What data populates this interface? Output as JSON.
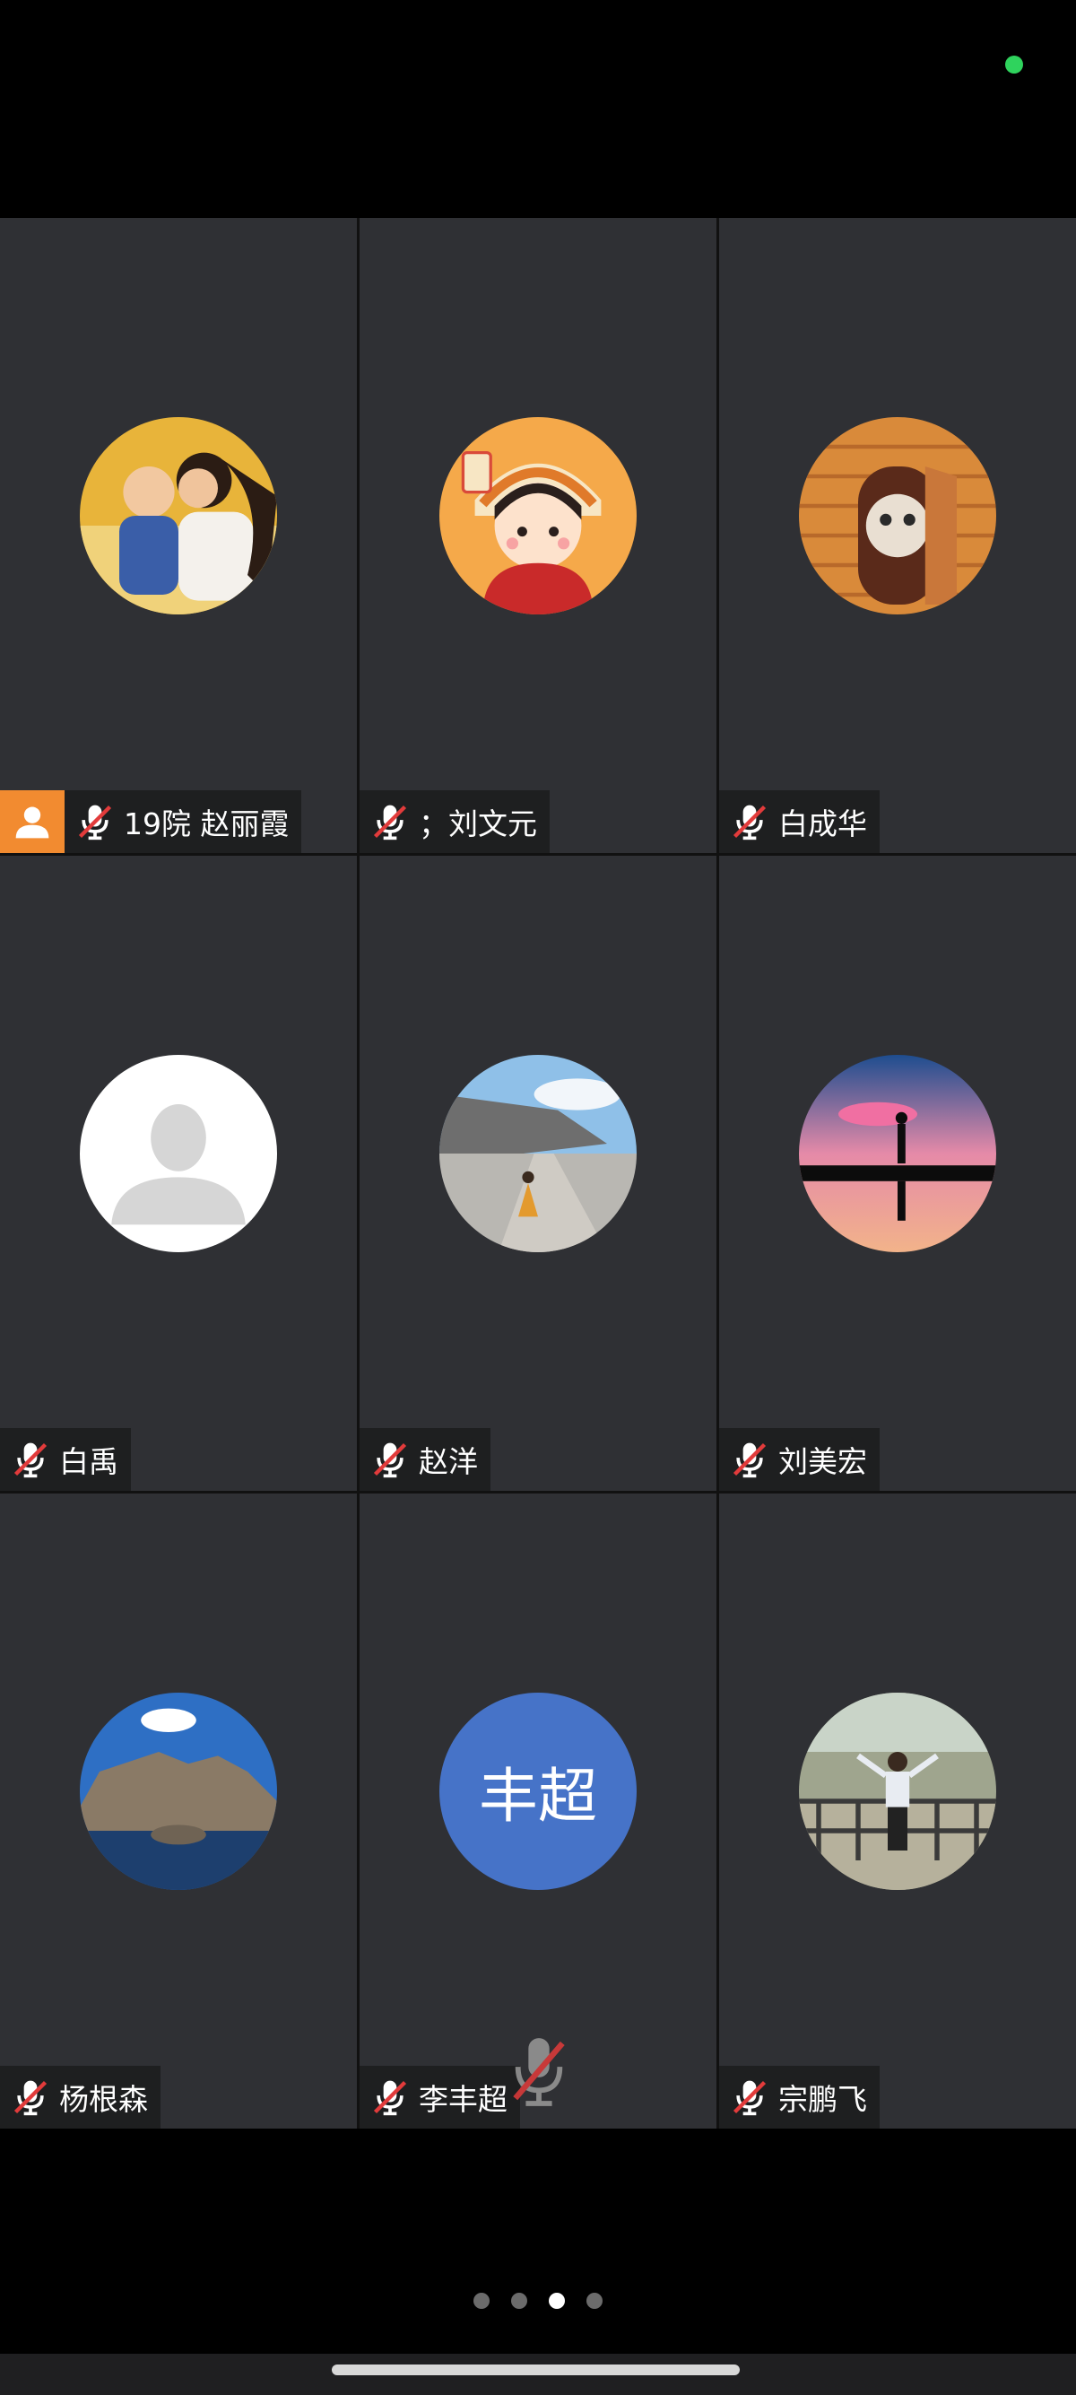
{
  "status": {
    "indicator_color": "#2fd35d"
  },
  "colors": {
    "tile_bg": "#2f3034",
    "host_badge": "#f28b30",
    "text_avatar_bg": "#4673c8",
    "mute_red": "#e23b3b"
  },
  "participants": [
    {
      "name": "19院 赵丽霞",
      "avatar": "photo-mother-child-avatar",
      "muted": true,
      "host": true
    },
    {
      "name": "；刘文元",
      "avatar": "cartoon-boy-tiger-hat-avatar",
      "muted": true,
      "host": false
    },
    {
      "name": "白成华",
      "avatar": "cat-at-door-avatar",
      "muted": true,
      "host": false
    },
    {
      "name": "白禹",
      "avatar": "default-person-avatar",
      "muted": true,
      "host": false
    },
    {
      "name": "赵洋",
      "avatar": "road-landscape-avatar",
      "muted": true,
      "host": false
    },
    {
      "name": "刘美宏",
      "avatar": "silhouette-sunset-avatar",
      "muted": true,
      "host": false
    },
    {
      "name": "杨根森",
      "avatar": "rocks-lake-avatar",
      "muted": true,
      "host": false
    },
    {
      "name": "李丰超",
      "avatar_text": "丰超",
      "muted": true,
      "host": false
    },
    {
      "name": "宗鹏飞",
      "avatar": "child-park-avatar",
      "muted": true,
      "host": false
    }
  ],
  "pagination": {
    "total": 4,
    "current": 3
  }
}
